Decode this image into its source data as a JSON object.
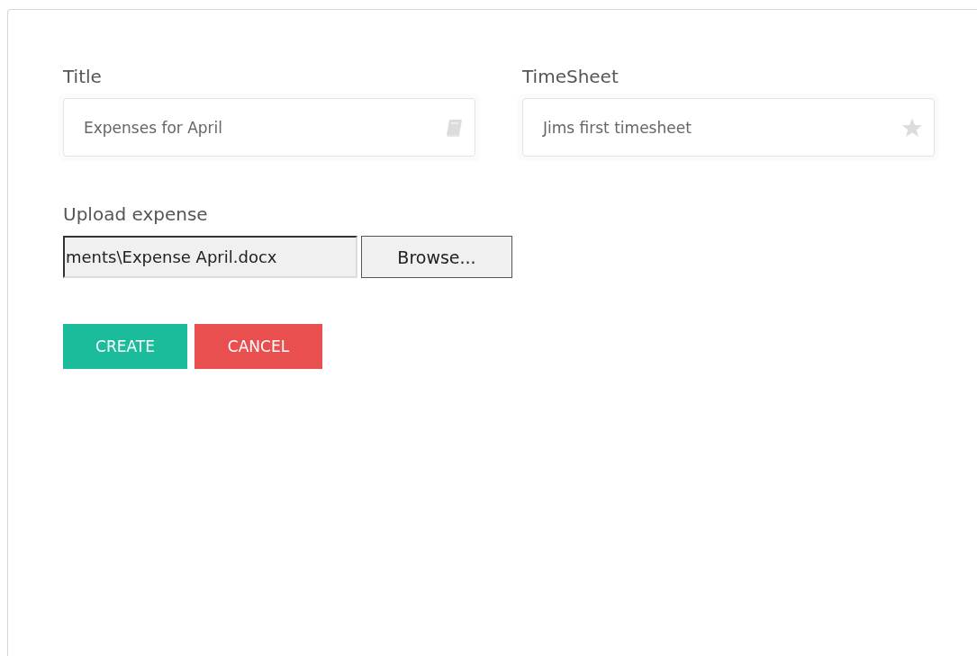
{
  "fields": [
    {
      "label": "Title",
      "value": "Expenses for April"
    },
    {
      "label": "TimeSheet",
      "value": "Jims first timesheet"
    }
  ],
  "upload": {
    "label": "Upload expense",
    "value": "ments\\Expense April.docx",
    "browse": "Browse..."
  },
  "buttons": [
    {
      "label": "CREATE",
      "kind": "primary"
    },
    {
      "label": "CANCEL",
      "kind": "danger"
    }
  ]
}
